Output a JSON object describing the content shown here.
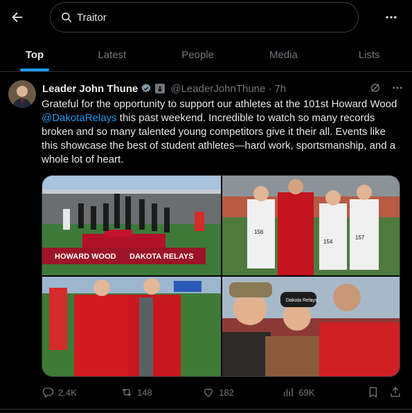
{
  "search": {
    "query": "Traitor"
  },
  "tabs": [
    {
      "label": "Top",
      "active": true
    },
    {
      "label": "Latest",
      "active": false
    },
    {
      "label": "People",
      "active": false
    },
    {
      "label": "Media",
      "active": false
    },
    {
      "label": "Lists",
      "active": false
    }
  ],
  "tweet": {
    "author_name": "Leader John Thune",
    "handle": "@LeaderJohnThune",
    "separator": "·",
    "time": "7h",
    "text_part1": "Grateful for the opportunity to support our athletes at the 101st Howard Wood ",
    "mention": "@DakotaRelays",
    "text_part2": " this past weekend. Incredible to watch so many records broken and so many talented young competitors give it their all. Events like this showcase the best of student athletes—hard work, sportsmanship, and a whole lot of heart.",
    "photo1_banner_left": "HOWARD WOOD",
    "photo1_banner_right": "DAKOTA RELAYS",
    "photo2_bibs": [
      "156",
      "154",
      "157"
    ],
    "photo4_cap": "Dakota Relays",
    "replies": "2.4K",
    "reposts": "148",
    "likes": "182",
    "views": "69K"
  },
  "colors": {
    "accent": "#1d9bf0",
    "muted": "#71767b",
    "text": "#e7e9ea",
    "border": "#2f3336"
  },
  "icons": [
    "back-arrow-icon",
    "search-icon",
    "more-icon",
    "verified-badge-icon",
    "government-badge-icon",
    "grok-icon",
    "reply-icon",
    "repost-icon",
    "like-icon",
    "views-icon",
    "bookmark-icon",
    "share-icon"
  ]
}
